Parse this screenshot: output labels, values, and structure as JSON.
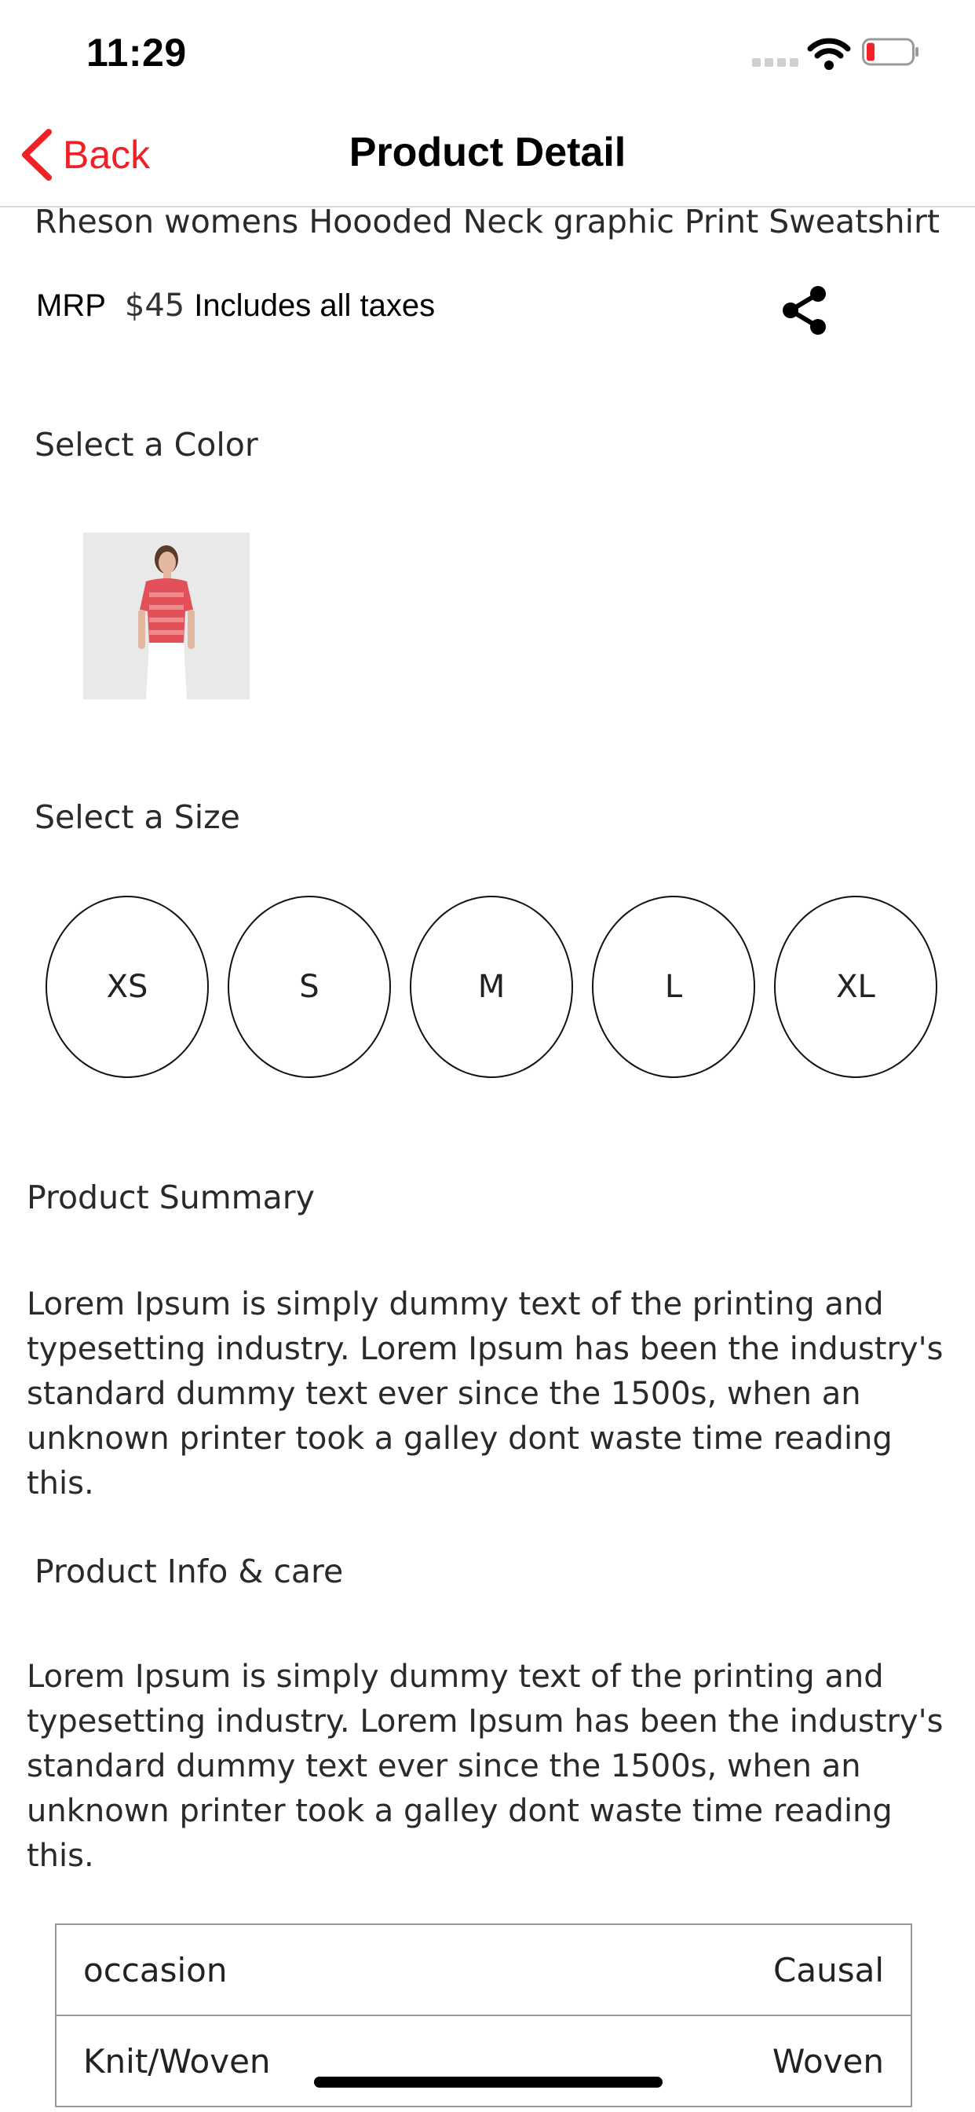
{
  "status_bar": {
    "time": "11:29"
  },
  "nav": {
    "back_label": "Back",
    "title": "Product Detail"
  },
  "product": {
    "name": "Rheson womens Hoooded Neck graphic Print Sweatshirt",
    "mrp_label": "MRP",
    "price": "$45",
    "tax_note": "Includes all taxes"
  },
  "colors": {
    "heading": "Select a Color"
  },
  "sizes": {
    "heading": "Select a Size",
    "options": [
      "XS",
      "S",
      "M",
      "L",
      "XL"
    ]
  },
  "summary": {
    "heading": "Product Summary",
    "text": " Lorem Ipsum is simply dummy text of the printing and typesetting industry. Lorem Ipsum has been the industry's standard dummy text ever since the 1500s, when an unknown printer took a galley dont waste time reading this."
  },
  "info": {
    "heading": "Product Info & care",
    "text": " Lorem Ipsum is simply dummy text of the printing and typesetting industry. Lorem Ipsum has been the industry's standard dummy text ever since the 1500s, when an unknown printer took a galley dont waste time reading this."
  },
  "attributes": [
    {
      "key": "occasion",
      "value": "Causal"
    },
    {
      "key": "Knit/Woven",
      "value": "Woven"
    }
  ],
  "theme": {
    "accent": "#f02026"
  }
}
